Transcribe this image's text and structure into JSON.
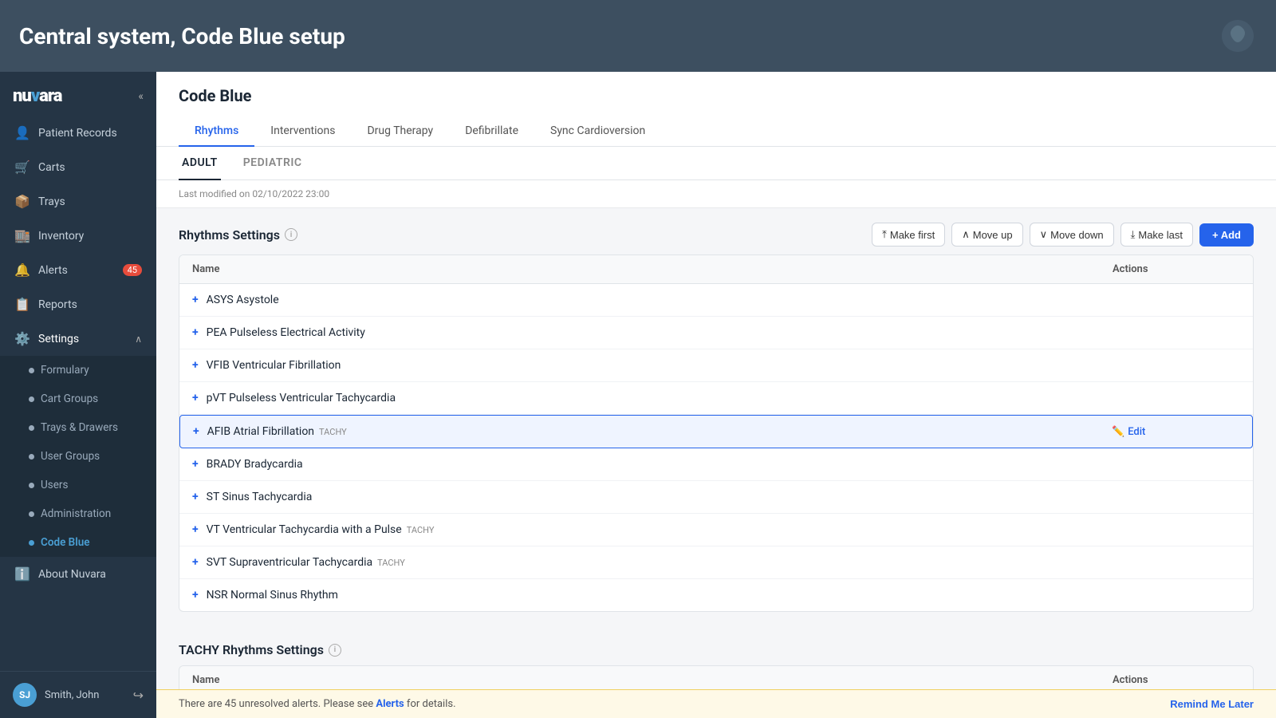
{
  "topBar": {
    "title": "Central system, Code Blue setup"
  },
  "sidebar": {
    "logoText": "nuvara",
    "navItems": [
      {
        "id": "patient-records",
        "label": "Patient Records",
        "icon": "👤",
        "badge": null
      },
      {
        "id": "carts",
        "label": "Carts",
        "icon": "🛒",
        "badge": null
      },
      {
        "id": "trays",
        "label": "Trays",
        "icon": "📦",
        "badge": null
      },
      {
        "id": "inventory",
        "label": "Inventory",
        "icon": "🏬",
        "badge": null
      },
      {
        "id": "alerts",
        "label": "Alerts",
        "icon": "🔔",
        "badge": "45"
      },
      {
        "id": "reports",
        "label": "Reports",
        "icon": "📋",
        "badge": null
      },
      {
        "id": "settings",
        "label": "Settings",
        "icon": "⚙️",
        "badge": null,
        "expanded": true
      }
    ],
    "subItems": [
      {
        "id": "formulary",
        "label": "Formulary"
      },
      {
        "id": "cart-groups",
        "label": "Cart Groups"
      },
      {
        "id": "trays-drawers",
        "label": "Trays & Drawers"
      },
      {
        "id": "user-groups",
        "label": "User Groups"
      },
      {
        "id": "users",
        "label": "Users"
      },
      {
        "id": "administration",
        "label": "Administration"
      },
      {
        "id": "code-blue",
        "label": "Code Blue",
        "active": true
      }
    ],
    "bottomItem": {
      "label": "About Nuvara",
      "icon": "ℹ️"
    },
    "user": {
      "initials": "SJ",
      "name": "Smith, John"
    }
  },
  "content": {
    "title": "Code Blue",
    "tabs": [
      {
        "id": "rhythms",
        "label": "Rhythms",
        "active": true
      },
      {
        "id": "interventions",
        "label": "Interventions",
        "active": false
      },
      {
        "id": "drug-therapy",
        "label": "Drug Therapy",
        "active": false
      },
      {
        "id": "defibrillate",
        "label": "Defibrillate",
        "active": false
      },
      {
        "id": "sync-cardioversion",
        "label": "Sync Cardioversion",
        "active": false
      }
    ],
    "subTabs": [
      {
        "id": "adult",
        "label": "ADULT",
        "active": true
      },
      {
        "id": "pediatric",
        "label": "PEDIATRIC",
        "active": false
      }
    ],
    "lastModified": "Last modified on 02/10/2022 23:00",
    "rhythmsSection": {
      "title": "Rhythms Settings",
      "actions": [
        {
          "id": "make-first",
          "label": "Make first",
          "icon": "⤒"
        },
        {
          "id": "move-up",
          "label": "Move up",
          "icon": "∧"
        },
        {
          "id": "move-down",
          "label": "Move down",
          "icon": "∨"
        },
        {
          "id": "make-last",
          "label": "Make last",
          "icon": "⤓"
        }
      ],
      "addLabel": "+ Add",
      "columns": [
        "Name",
        "Actions"
      ],
      "rows": [
        {
          "id": "asys",
          "name": "ASYS Asystole",
          "tag": "",
          "selected": false
        },
        {
          "id": "pea",
          "name": "PEA Pulseless Electrical Activity",
          "tag": "",
          "selected": false
        },
        {
          "id": "vfib",
          "name": "VFIB Ventricular Fibrillation",
          "tag": "",
          "selected": false
        },
        {
          "id": "pvt",
          "name": "pVT Pulseless Ventricular Tachycardia",
          "tag": "",
          "selected": false
        },
        {
          "id": "afib",
          "name": "AFIB Atrial Fibrillation",
          "tag": "TACHY",
          "selected": true
        },
        {
          "id": "brady",
          "name": "BRADY Bradycardia",
          "tag": "",
          "selected": false
        },
        {
          "id": "st",
          "name": "ST Sinus Tachycardia",
          "tag": "",
          "selected": false
        },
        {
          "id": "vt",
          "name": "VT Ventricular Tachycardia with a Pulse",
          "tag": "TACHY",
          "selected": false
        },
        {
          "id": "svt",
          "name": "SVT Supraventricular Tachycardia",
          "tag": "TACHY",
          "selected": false
        },
        {
          "id": "nsr",
          "name": "NSR Normal Sinus Rhythm",
          "tag": "",
          "selected": false
        }
      ]
    },
    "tachySection": {
      "title": "TACHY Rhythms Settings",
      "columns": [
        "Name",
        "Actions"
      ]
    }
  },
  "alertBar": {
    "text": "There are 45 unresolved alerts. Please see ",
    "linkText": "Alerts",
    "textEnd": " for details.",
    "remindLabel": "Remind Me Later"
  }
}
